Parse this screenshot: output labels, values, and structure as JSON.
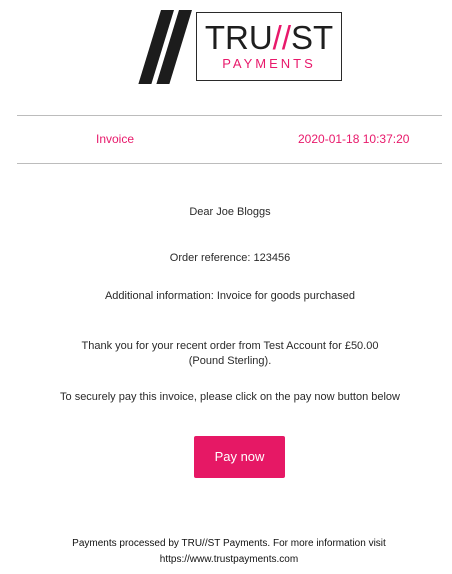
{
  "logo": {
    "word_left": "TRU",
    "word_slashes": "//",
    "word_right": "ST",
    "sub": "PAYMENTS"
  },
  "invoice_header": {
    "label": "Invoice",
    "datetime": "2020-01-18 10:37:20"
  },
  "body": {
    "greeting": "Dear Joe Bloggs",
    "order_reference": "Order reference: 123456",
    "additional_info": "Additional information: Invoice for goods purchased",
    "thanks_line1": "Thank you for your recent order from Test Account for £50.00",
    "thanks_line2": "(Pound Sterling).",
    "secure_pay": "To securely pay this invoice, please click on the pay now button below"
  },
  "pay_button": {
    "label": "Pay now"
  },
  "footer": {
    "line1": "Payments processed by TRU//ST Payments. For more information visit",
    "line2": "https://www.trustpayments.com"
  },
  "colors": {
    "brand_pink": "#e8196b",
    "button_bg": "#e61865",
    "text": "#222222",
    "rule": "#bcbcbc"
  }
}
